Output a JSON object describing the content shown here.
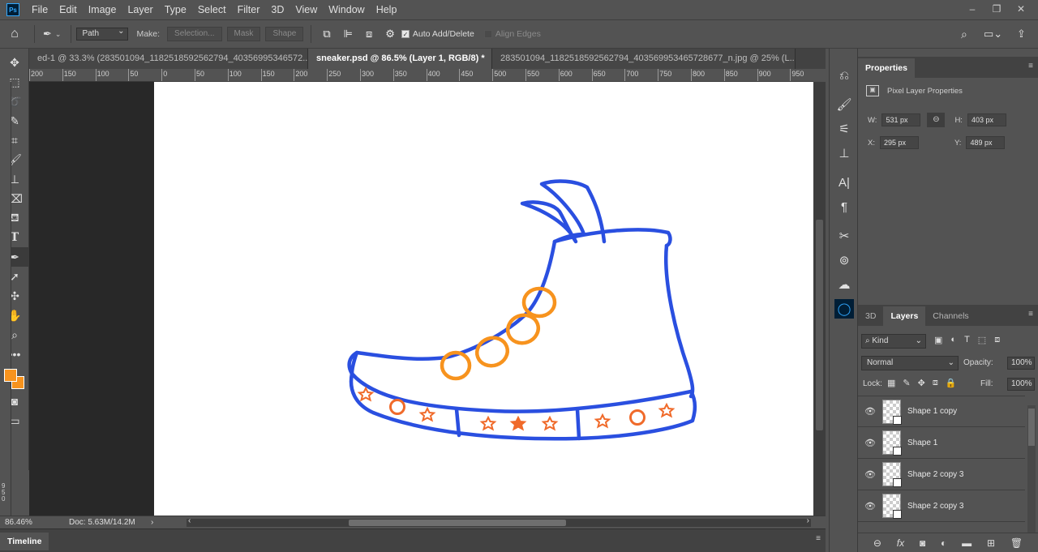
{
  "menubar": {
    "logo": "Ps",
    "items": [
      "File",
      "Edit",
      "Image",
      "Layer",
      "Type",
      "Select",
      "Filter",
      "3D",
      "View",
      "Window",
      "Help"
    ],
    "window_controls": [
      "–",
      "❐",
      "✕"
    ]
  },
  "options": {
    "path_mode": "Path",
    "make_label": "Make:",
    "selection_btn": "Selection...",
    "mask_btn": "Mask",
    "shape_btn": "Shape",
    "auto_add_delete": "Auto Add/Delete",
    "align_edges": "Align Edges"
  },
  "tabs": [
    {
      "label": "ed-1 @ 33.3% (283501094_1182518592562794_40356995346572...",
      "close": "×"
    },
    {
      "label": "sneaker.psd @ 86.5% (Layer 1, RGB/8) *",
      "close": "×"
    },
    {
      "label": "283501094_1182518592562794_403569953465728677_n.jpg @ 25% (L...",
      "close": "×"
    }
  ],
  "ruler_top_labels": [
    "200",
    "150",
    "100",
    "50",
    "0",
    "50",
    "100",
    "150",
    "200",
    "250",
    "300",
    "350",
    "400",
    "450",
    "500",
    "550",
    "600",
    "650",
    "700",
    "750",
    "800",
    "850",
    "900",
    "950"
  ],
  "ruler_left_label": "950",
  "status": {
    "zoom": "86.46%",
    "doc": "Doc: 5.63M/14.2M",
    "arrow": "›",
    "left_arrow": "‹",
    "right_arrow": "›"
  },
  "timeline": {
    "label": "Timeline"
  },
  "properties": {
    "tab": "Properties",
    "section": "Pixel Layer Properties",
    "w_label": "W:",
    "w": "531 px",
    "h_label": "H:",
    "h": "403 px",
    "x_label": "X:",
    "x": "295 px",
    "y_label": "Y:",
    "y": "489 px"
  },
  "layers_panel": {
    "tabs": [
      "3D",
      "Layers",
      "Channels"
    ],
    "kind": "Kind",
    "blend_mode": "Normal",
    "opacity_label": "Opacity:",
    "opacity": "100%",
    "lock_label": "Lock:",
    "fill_label": "Fill:",
    "fill": "100%",
    "layers": [
      {
        "name": "Shape 1 copy"
      },
      {
        "name": "Shape 1"
      },
      {
        "name": "Shape 2 copy 3"
      },
      {
        "name": "Shape 2 copy 3"
      }
    ]
  },
  "colors": {
    "foreground": "#f7931e",
    "background": "#f7931e",
    "shoe_outline": "#2a4fe0",
    "laces": "#f7931e",
    "sole_decor": "#f06a2a"
  }
}
